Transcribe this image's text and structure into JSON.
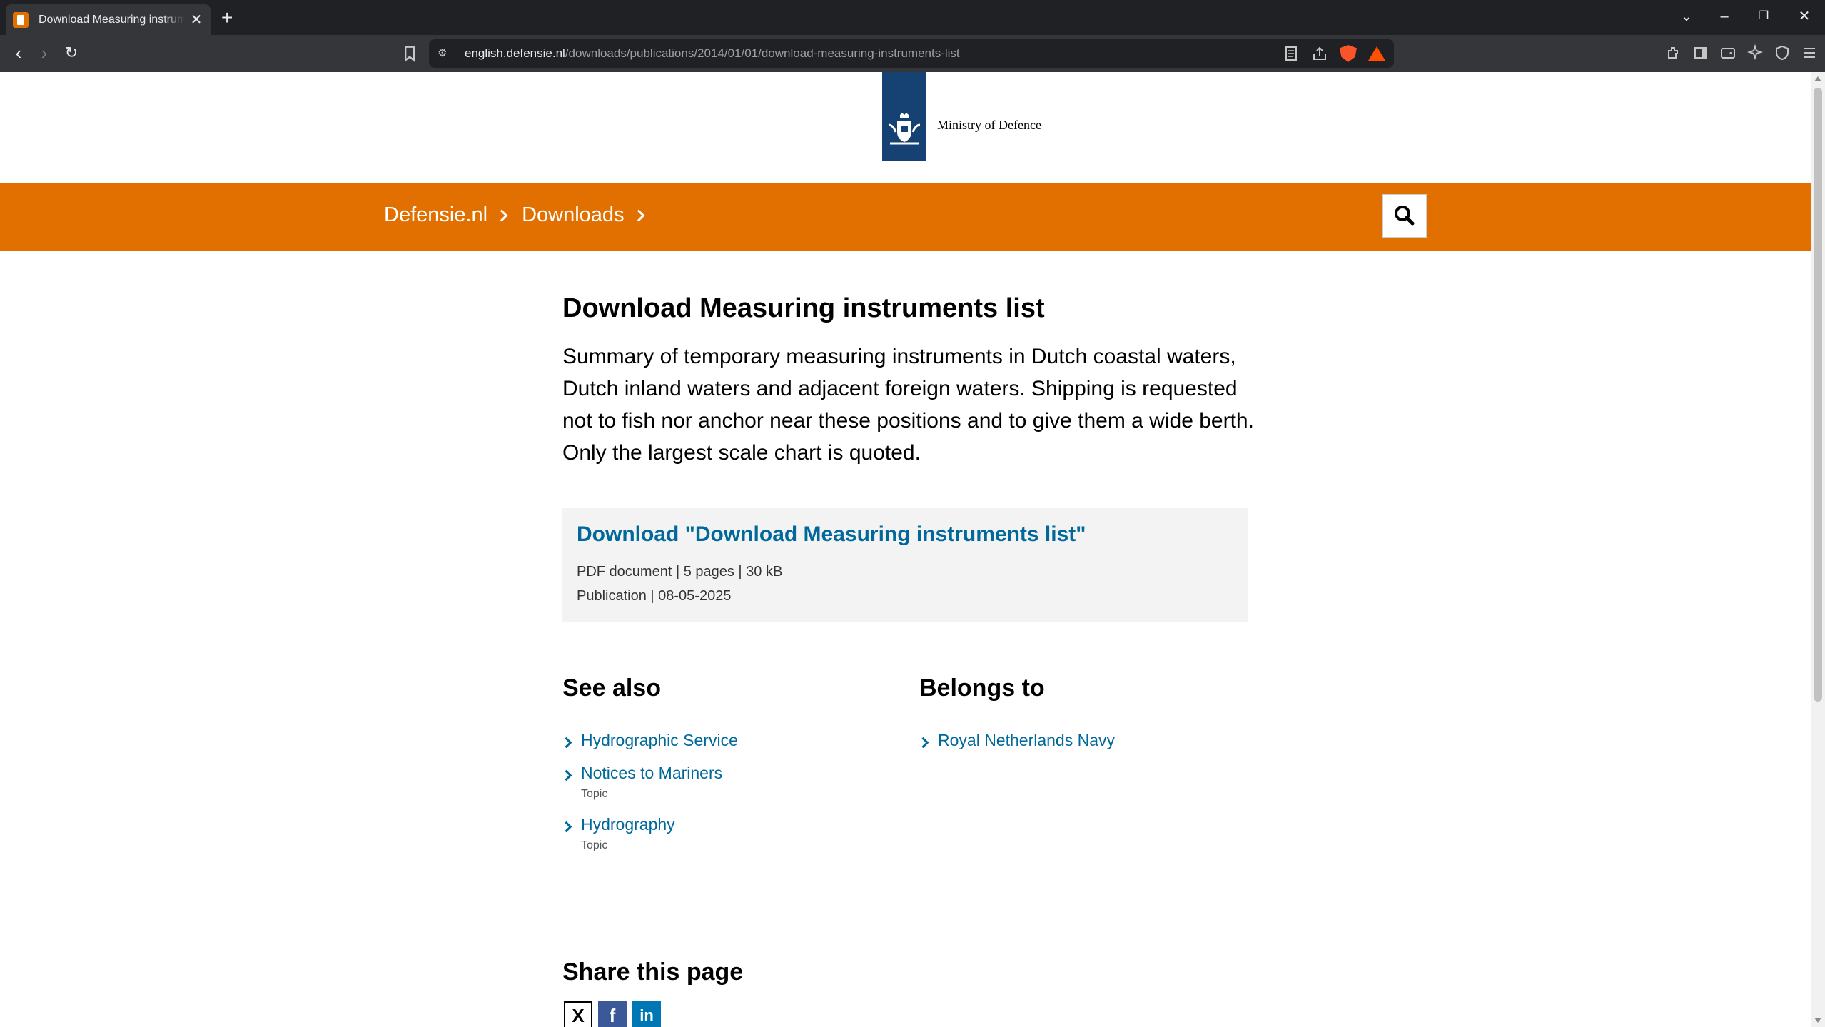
{
  "browser": {
    "tab_title": "Download Measuring instruments list",
    "url_host": "english.defensie.nl",
    "url_path": "/downloads/publications/2014/01/01/download-measuring-instruments-list"
  },
  "site": {
    "logo_text": "Ministry of Defence",
    "breadcrumbs": [
      "Defensie.nl",
      "Downloads"
    ]
  },
  "main": {
    "title": "Download Measuring instruments list",
    "intro": "Summary of temporary measuring instruments in Dutch coastal waters, Dutch inland waters and adjacent foreign waters. Shipping is requested not to fish nor anchor near these positions and to give them a wide berth. Only the largest scale chart is quoted.",
    "download": {
      "link": "Download \"Download Measuring instruments list\"",
      "meta": "PDF document | 5 pages | 30 kB",
      "publication": "Publication | 08-05-2025"
    }
  },
  "see_also": {
    "heading": "See also",
    "items": [
      {
        "label": "Hydrographic Service",
        "sub": ""
      },
      {
        "label": "Notices to Mariners",
        "sub": "Topic"
      },
      {
        "label": "Hydrography",
        "sub": "Topic"
      }
    ]
  },
  "belongs_to": {
    "heading": "Belongs to",
    "items": [
      {
        "label": "Royal Netherlands Navy"
      }
    ]
  },
  "share": {
    "heading": "Share this page"
  },
  "colors": {
    "orange": "#e17000",
    "link": "#01689b",
    "logo_blue": "#154273"
  }
}
